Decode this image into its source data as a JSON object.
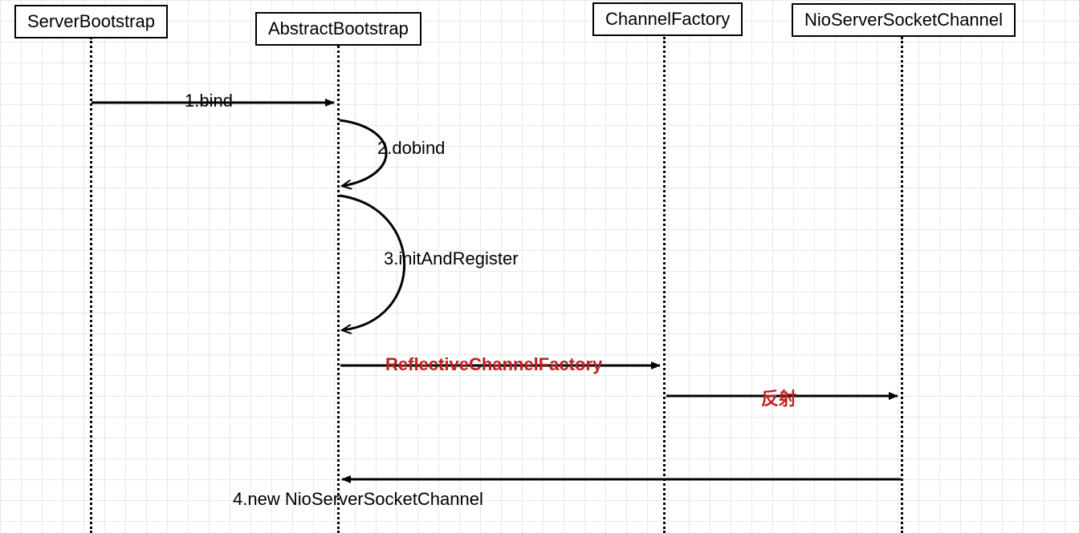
{
  "participants": {
    "p1": "ServerBootstrap",
    "p2": "AbstractBootstrap",
    "p3": "ChannelFactory",
    "p4": "NioServerSocketChannel"
  },
  "messages": {
    "m1": "1.bind",
    "m2": "2.dobind",
    "m3": "3.initAndRegister",
    "m4": "ReflectiveChannelFactory",
    "m5": "反射",
    "m6": "4.new NioServerSocketChannel"
  },
  "colors": {
    "highlight": "#c02020"
  }
}
